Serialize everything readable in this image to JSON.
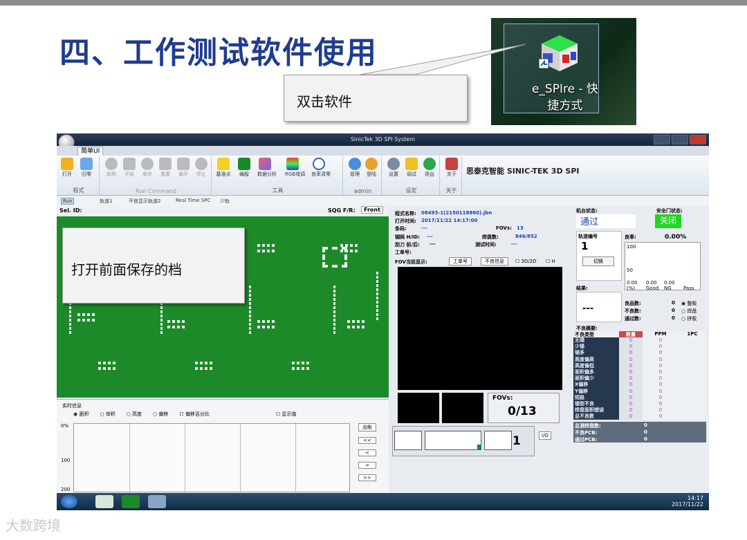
{
  "slide": {
    "title": "四、工作测试软件使用",
    "callout_double_click": "双击软件",
    "callout_open_file": "打开前面保存的档",
    "watermark": "大数跨境"
  },
  "desktop_icon": {
    "label_line1": "e_SPIre - 快",
    "label_line2": "捷方式"
  },
  "app": {
    "window_title": "SinicTek 3D SPI System",
    "tab": "简单UI",
    "ribbon": {
      "groups": [
        {
          "label": "程式",
          "buttons": [
            "打开",
            "归零"
          ]
        },
        {
          "label": "Run Command",
          "buttons": [
            "轨制",
            "开始",
            "单步",
            "重置",
            "循环",
            "停止"
          ]
        },
        {
          "label": "工具",
          "buttons": [
            "基准点",
            "编程",
            "数据分析",
            "RGB增调",
            "良率清零"
          ]
        },
        {
          "label": "admin",
          "buttons": [
            "管理",
            "登陆"
          ]
        },
        {
          "label": "设定",
          "buttons": [
            "设置",
            "调试",
            "退出"
          ]
        },
        {
          "label": "关于",
          "buttons": [
            "关于"
          ]
        }
      ],
      "brand": "思泰克智能 SINIC-TEK 3D SPI"
    },
    "subtabs": [
      "Run",
      "轨道1",
      "不良显示轨道2",
      "Real Time SPC",
      "少轨"
    ],
    "board_header": {
      "sel_id": "Sel. ID:",
      "sqg": "SQG F/R:",
      "front": "Front"
    },
    "realtime": {
      "title": "实时信息",
      "radios": [
        "面积",
        "体积",
        "高度",
        "偏移"
      ],
      "checkboxes": [
        "偏移百分比",
        "显示值"
      ],
      "yaxis": [
        "0%",
        "100",
        "200"
      ],
      "buttons": [
        "出帐",
        "<<",
        "<",
        ">",
        ">>"
      ]
    },
    "program": {
      "name_label": "程式名称:",
      "name": "08493-1(2150118860).jbn",
      "open_time_label": "打开时间:",
      "open_time": "2017/11/22 14:17:00",
      "barcode_label": "条码:",
      "barcode": "---",
      "fovs_label": "FOVs:",
      "fovs": "13",
      "stencil_label": "钢网 H/ID:",
      "stencil": "---",
      "joints_label": "焊盘数:",
      "joints": "846/852",
      "squeegee_label": "刮刀 前/后:",
      "squeegee": "---",
      "test_time_label": "测试时间:",
      "test_time": "---",
      "workorder_label": "工单号:"
    },
    "fov": {
      "title": "FOV当前显示:",
      "btn_order": "工单号",
      "btn_defect": "不良信息",
      "chk_3d": "3D/2D",
      "chk_h": "H",
      "fovs_label": "FOVs:",
      "fovs_value": "0/13",
      "io": "I/O",
      "count": "1"
    },
    "status": {
      "machine_label": "机台状态:",
      "machine_value": "通过",
      "safety_label": "安全门状态:",
      "safety_value": "关闭",
      "track_label": "轨道编号",
      "track_value": "1",
      "switch_btn": "切换",
      "result_label": "结果:",
      "result_value": "---",
      "yield_label": "良率:",
      "yield_value": "0.00%",
      "yield_axis": [
        "100",
        "50"
      ],
      "yield_cols": [
        "(%)",
        "Good",
        "NG",
        "Pass"
      ],
      "yield_vals": [
        "0.00",
        "0.00",
        "0.00"
      ],
      "good_label": "良品数:",
      "good": "0",
      "bad_label": "不良数:",
      "bad": "0",
      "pass_label": "通过数:",
      "pass": "0",
      "radios": [
        "整板",
        "焊盘",
        "拼板"
      ]
    },
    "defects": {
      "title": "不良摘要:",
      "headers": [
        "不良类型",
        "数量",
        "PPM",
        "1PC"
      ],
      "rows": [
        "无锡",
        "少锡",
        "锡多",
        "高度偏高",
        "高度偏低",
        "面积偏多",
        "面积偏少",
        "X偏移",
        "Y偏移",
        "短路",
        "锡型不良",
        "焊盘面积错误",
        "总不良数"
      ],
      "values": [
        "0",
        "0",
        "0",
        "0",
        "0",
        "0",
        "0",
        "0",
        "0",
        "0",
        "0",
        "0",
        "0"
      ],
      "total_label": "总测焊盘数:",
      "bad_pcb_label": "不良PCB:",
      "pass_pcb_label": "通过PCB:",
      "summary_values": [
        "0",
        "0",
        "0"
      ]
    },
    "taskbar": {
      "time": "14:17",
      "date": "2017/11/22"
    },
    "colors": {
      "board": "#1d8a2a",
      "machine_value": "#1e3fb5",
      "safety_bg": "#22d622"
    }
  }
}
